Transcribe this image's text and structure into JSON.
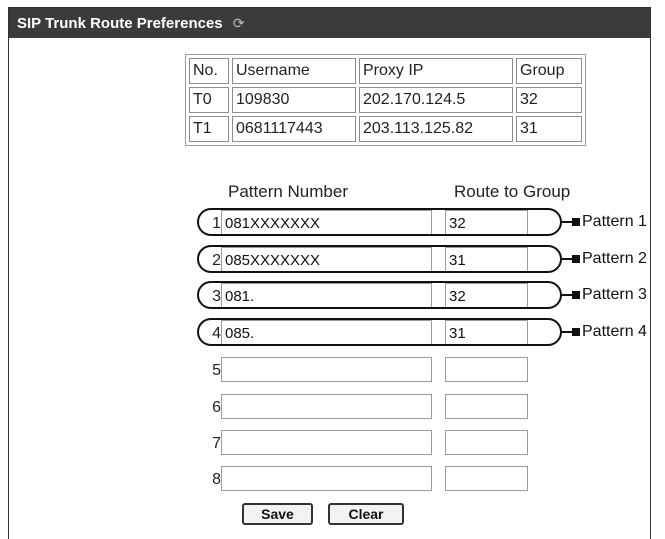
{
  "title": "SIP Trunk Route Preferences",
  "refresh_icon": "refresh-icon",
  "trunk_table": {
    "headers": [
      "No.",
      "Username",
      "Proxy IP",
      "Group"
    ],
    "rows": [
      [
        "T0",
        "109830",
        "202.170.124.5",
        "32"
      ],
      [
        "T1",
        "0681117443",
        "203.113.125.82",
        "31"
      ]
    ]
  },
  "pattern_header": "Pattern Number",
  "route_header": "Route to Group",
  "patterns": [
    {
      "num": "1",
      "pattern": "081XXXXXXX",
      "group": "32",
      "callout": "Pattern 1"
    },
    {
      "num": "2",
      "pattern": "085XXXXXXX",
      "group": "31",
      "callout": "Pattern 2"
    },
    {
      "num": "3",
      "pattern": "081.",
      "group": "32",
      "callout": "Pattern 3"
    },
    {
      "num": "4",
      "pattern": "085.",
      "group": "31",
      "callout": "Pattern 4"
    },
    {
      "num": "5",
      "pattern": "",
      "group": ""
    },
    {
      "num": "6",
      "pattern": "",
      "group": ""
    },
    {
      "num": "7",
      "pattern": "",
      "group": ""
    },
    {
      "num": "8",
      "pattern": "",
      "group": ""
    }
  ],
  "buttons": {
    "save": "Save",
    "clear": "Clear"
  }
}
